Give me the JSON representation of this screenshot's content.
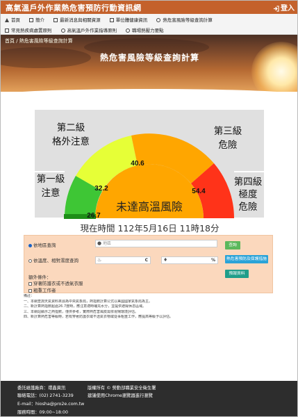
{
  "header": {
    "site_title": "高氣溫戶外作業熱危害預防行動資訊網",
    "login_label": "登入"
  },
  "nav": {
    "row1": [
      "首頁",
      "簡介",
      "最新消息與相關資源",
      "單位體健康資訊",
      "熱危害風險等級查詢計算"
    ],
    "row2": [
      "常見熱疾病處置原則",
      "高氣溫戶外作業指導原則",
      "職場熱壓力要點"
    ]
  },
  "banner": {
    "breadcrumb": "首頁 / 熱危害風險等級查詢計算",
    "title": "熱危害風險等級查詢計算"
  },
  "gauge": {
    "level1": [
      "第一級",
      "注意"
    ],
    "level2": [
      "第二級",
      "格外注意"
    ],
    "level3": [
      "第三級",
      "危險"
    ],
    "level4": [
      "第四級",
      "極度",
      "危險"
    ],
    "thresholds": [
      "26.7",
      "32.2",
      "40.6",
      "54.4"
    ],
    "status": "未達高溫風險",
    "colors": {
      "level1": "#3ec635",
      "level2": "#e6ff37",
      "level3": "#ffa600",
      "level4": "#ff3319",
      "needle": "#1d8e17",
      "panel": "#e0e0e0"
    }
  },
  "time_label": "現在時間 112年5月16日 11時18分",
  "form": {
    "option1": "依地區查詢",
    "option2": "依溫度、相對濕度查詢",
    "region_placeholder": "地區",
    "temp_unit": "C",
    "humidity_unit": "%",
    "work_condition_label": "額外條件：",
    "checkbox1": "穿著防護衣或不透氣衣服",
    "checkbox2": "粗重工作者",
    "query_button": "查詢",
    "prevention_button": "熱危害預防及保護措施",
    "forecast_button": "預報資料"
  },
  "notes": {
    "heading": "備註：",
    "lines": [
      "一、本網查詢天氣資料來源為中央氣象局，熱指數計算公式以美國國家氣象局為主。",
      "二、新計算熱指數超過26.7度時，應注意適時補充水分，並提供遮陽休息區域。",
      "三、本網站顯示之熱指數，僅供參考，實際熱危害風險需依現場環境評估。",
      "四、新計算熱危害等級時，若有穿著防護衣或不透氣衣物或從事粗重工作，應提高等級予以評估。"
    ]
  },
  "footer": {
    "commission_label": "委託維護廠商：",
    "commission_value": "環鑫資訊",
    "copyright": "版權所有 © 勞動部職業安全衛生署",
    "phone_label": "聯絡電話：",
    "phone_value": "(02) 2741-3239",
    "browser_note": "建議使用Chrome瀏覽器進行瀏覽",
    "email_label": "E-mail：",
    "email_value": "hiosha@pro2e.com.tw",
    "hours_label": "服務時間：",
    "hours_value": "09:00~18:00"
  }
}
